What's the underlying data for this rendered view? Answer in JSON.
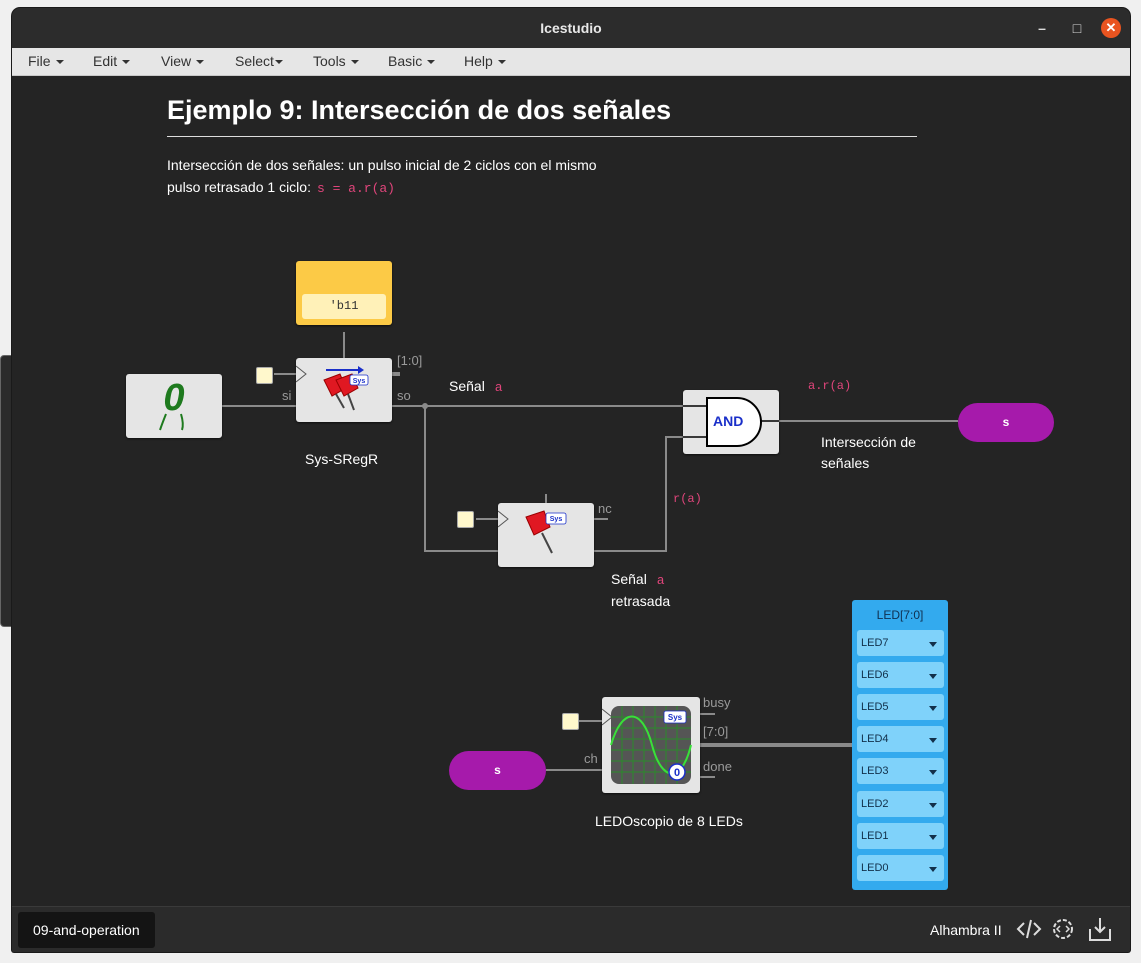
{
  "window": {
    "title": "Icestudio"
  },
  "menu": {
    "items": [
      {
        "label": "File"
      },
      {
        "label": "Edit"
      },
      {
        "label": "View"
      },
      {
        "label": "Select"
      },
      {
        "label": "Tools"
      },
      {
        "label": "Basic"
      },
      {
        "label": "Help"
      }
    ]
  },
  "doc": {
    "title": "Ejemplo 9: Intersección de dos señales",
    "desc_line1": "Intersección de dos señales: un pulso inicial de 2 ciclos con el mismo",
    "desc_line2": "pulso retrasado 1 ciclo:",
    "desc_code": "s = a.r(a)"
  },
  "blocks": {
    "const_value": "'b11",
    "sregr": {
      "label": "Sys-SRegR",
      "pin_si": "si",
      "pin_so": "so",
      "pin_width": "[1:0]",
      "badge": "Sys"
    },
    "zero_label": "0",
    "signal_a": {
      "text": "Señal",
      "code": "a"
    },
    "and_gate": {
      "label": "AND",
      "out_code": "a.r(a)"
    },
    "out_s": "s",
    "inter_label_1": "Intersección de",
    "inter_label_2": "señales",
    "delay": {
      "badge": "Sys",
      "pin_nc": "nc",
      "r_code": "r(a)"
    },
    "delayed": {
      "text1": "Señal",
      "code": "a",
      "text2": "retrasada"
    },
    "in_s": "s",
    "scope": {
      "label": "LEDOscopio de 8 LEDs",
      "pin_ch": "ch",
      "pin_busy": "busy",
      "pin_bus": "[7:0]",
      "pin_done": "done",
      "badge": "Sys",
      "zero": "0"
    },
    "leds": {
      "header": "LED[7:0]",
      "items": [
        "LED7",
        "LED6",
        "LED5",
        "LED4",
        "LED3",
        "LED2",
        "LED1",
        "LED0"
      ]
    }
  },
  "status": {
    "tab": "09-and-operation",
    "board": "Alhambra II"
  },
  "colors": {
    "accent_purple": "#a61aab",
    "led_panel": "#33aaee",
    "const_yellow": "#fcca46",
    "code_pink": "#e0457b"
  }
}
